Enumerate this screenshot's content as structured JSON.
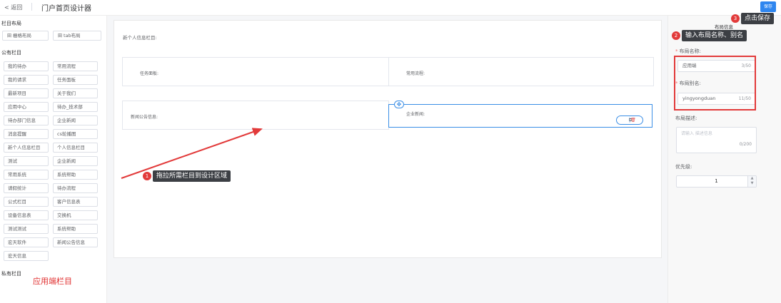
{
  "topbar": {
    "back_label": "< 返回",
    "title": "门户首页设计器",
    "save_label": "保存"
  },
  "left": {
    "layout_heading": "栏目布局",
    "layout_buttons": [
      {
        "icon": "田",
        "label": "栅格布局"
      },
      {
        "icon": "田",
        "label": "tab布局"
      }
    ],
    "public_heading": "公有栏目",
    "public_items": [
      "我的待办",
      "常用流程",
      "我的请求",
      "任务面板",
      "最新项目",
      "关于我们",
      "应用中心",
      "待办_技术部",
      "待办部门信息",
      "企业新闻",
      "消息提醒",
      "cs轮播图",
      "新个人信息栏目",
      "个人信息栏目",
      "测试",
      "企业新闻",
      "常用系统",
      "系统帮助",
      "请假统计",
      "待办流程",
      "公式栏目",
      "客户信息表",
      "设备信息表",
      "交换机",
      "测试测试",
      "系统帮助",
      "宏天软件",
      "新闻公告信息",
      "宏天信息"
    ],
    "private_heading": "私有栏目",
    "annotation": "应用端栏目"
  },
  "canvas": {
    "block_title": "新个人信息栏目:",
    "cells": [
      "任务面板:",
      "常用流程:",
      "新闻公告信息:",
      "企业新闻:"
    ],
    "move_icon": "✥",
    "copy_icon": "⧉",
    "delete_icon": "🗑"
  },
  "right": {
    "header": "布局信息",
    "name_label": "布局名称:",
    "name_value": "应用端",
    "name_count": "3/50",
    "alias_label": "布局别名:",
    "alias_value": "yingyongduan",
    "alias_count": "11/50",
    "desc_label": "布局描述:",
    "desc_placeholder": "请输入 描述信息",
    "desc_count": "0/200",
    "priority_label": "优先级:",
    "priority_value": "1"
  },
  "callouts": [
    {
      "num": "1",
      "text": "拖拉所需栏目到设计区域"
    },
    {
      "num": "2",
      "text": "输入布局名称、别名"
    },
    {
      "num": "3",
      "text": "点击保存"
    }
  ],
  "colors": {
    "primary": "#2f86ef",
    "annotation_red": "#e23a3a",
    "tip_bg": "#3c3f44"
  }
}
